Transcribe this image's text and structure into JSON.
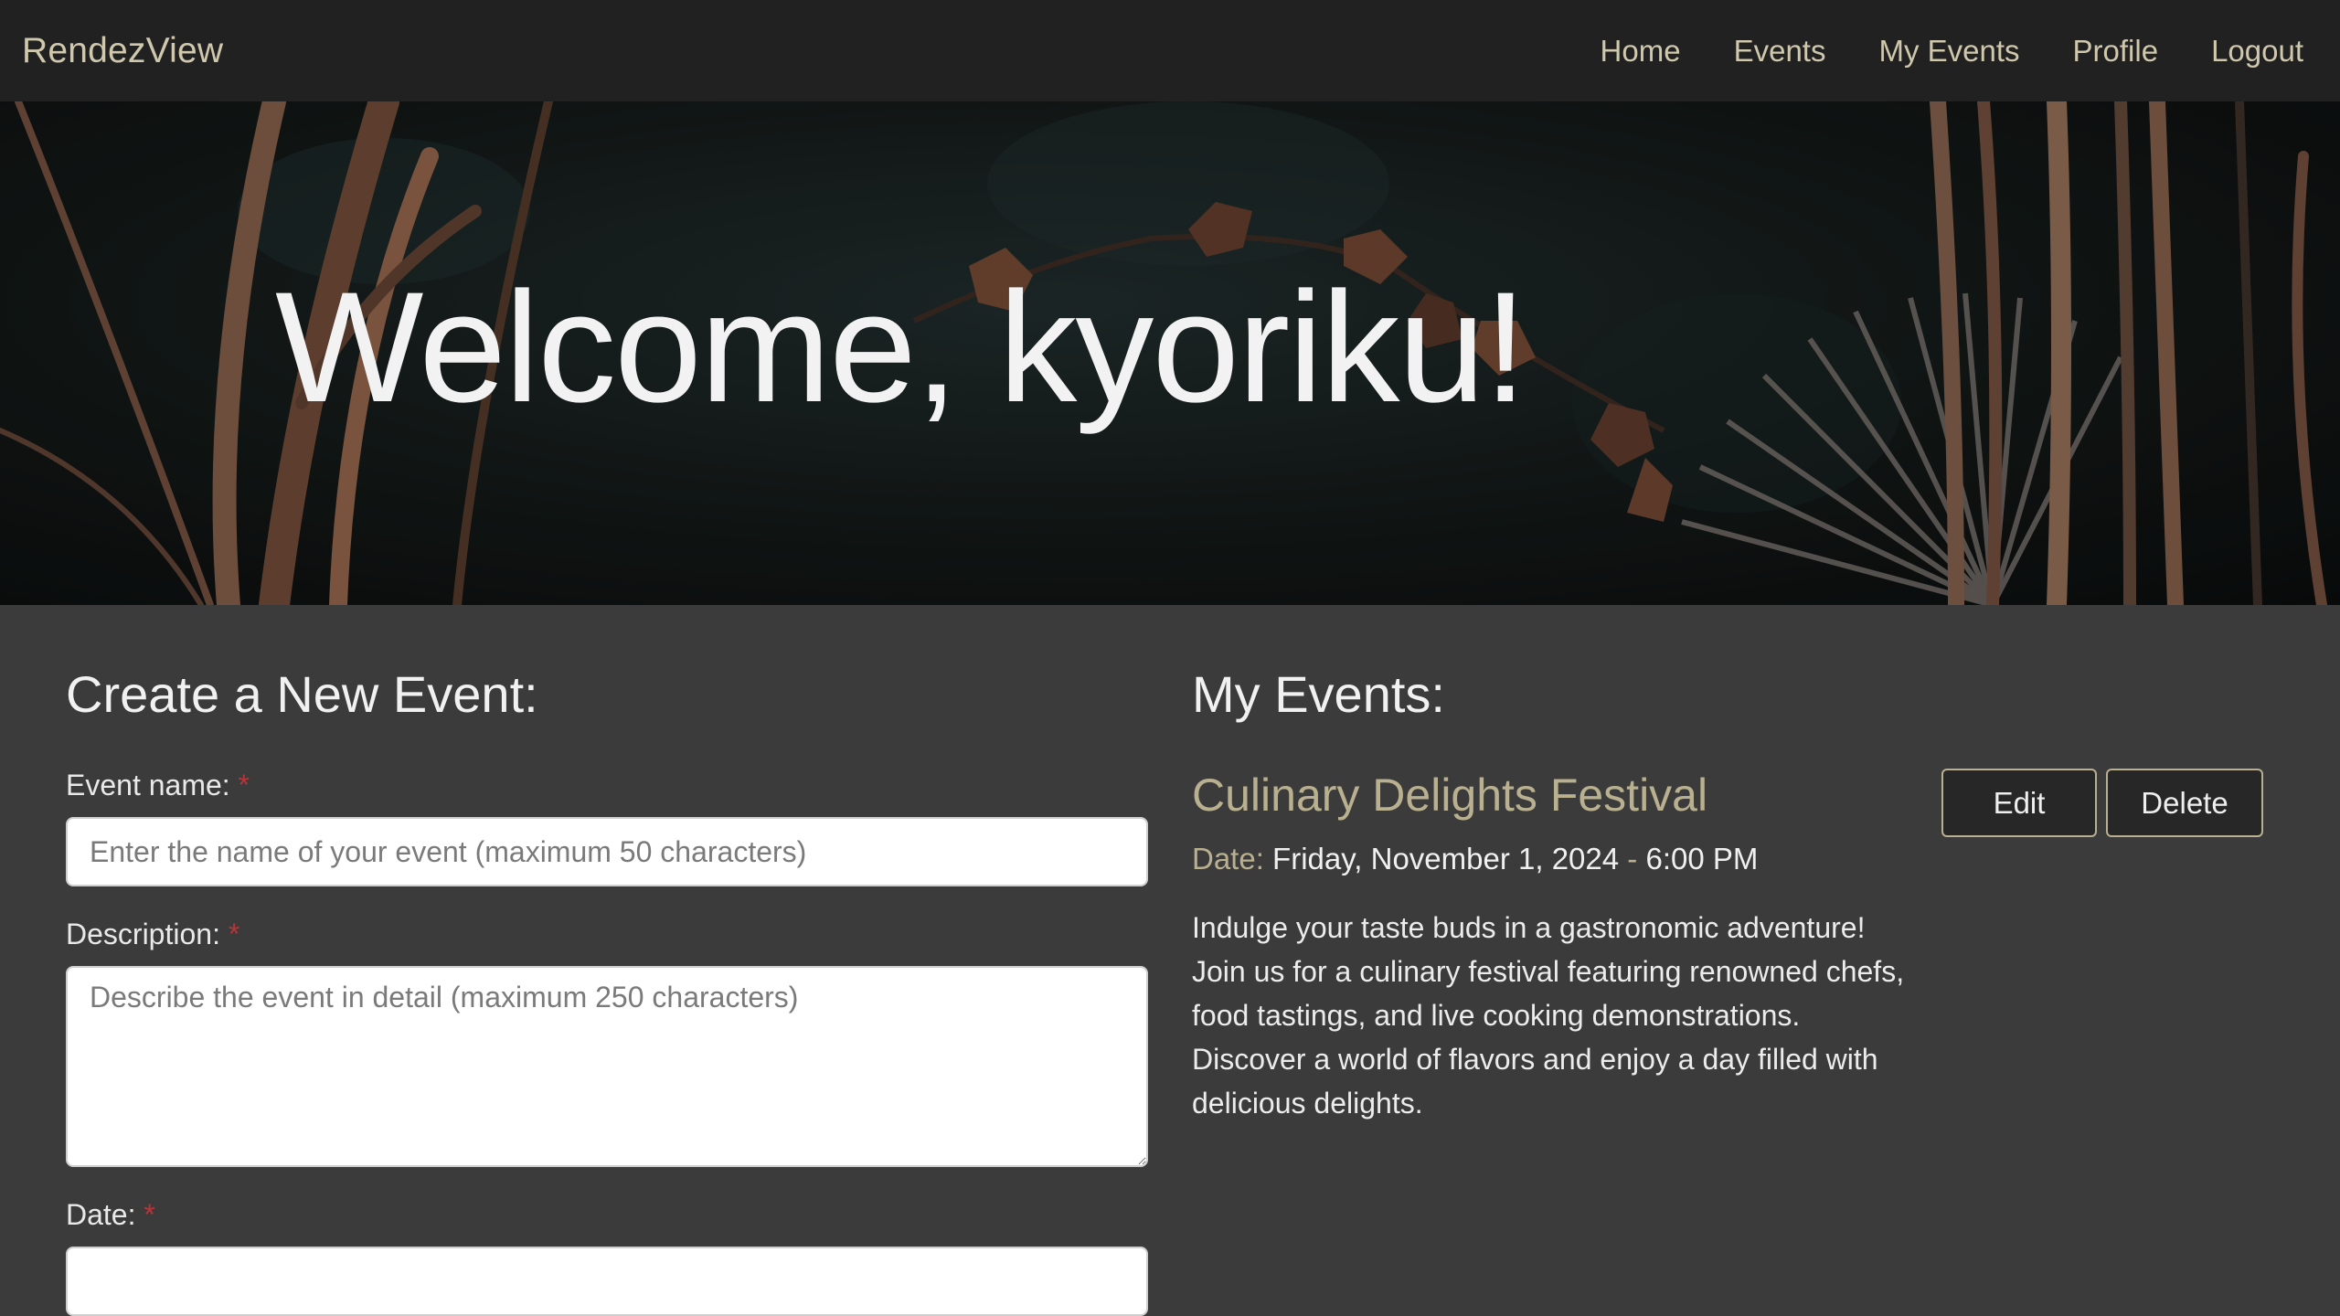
{
  "navbar": {
    "brand": "RendezView",
    "links": [
      "Home",
      "Events",
      "My Events",
      "Profile",
      "Logout"
    ]
  },
  "hero": {
    "title": "Welcome, kyoriku!"
  },
  "create_form": {
    "title": "Create a New Event:",
    "name_label": "Event name:",
    "name_placeholder": "Enter the name of your event (maximum 50 characters)",
    "description_label": "Description:",
    "description_placeholder": "Describe the event in detail (maximum 250 characters)",
    "date_label": "Date:",
    "required_marker": "*"
  },
  "my_events": {
    "title": "My Events:",
    "events": [
      {
        "name": "Culinary Delights Festival",
        "date_label": "Date:",
        "date": "Friday, November 1, 2024",
        "separator": "-",
        "time": "6:00 PM",
        "description": "Indulge your taste buds in a gastronomic adventure! Join us for a culinary festival featuring renowned chefs, food tastings, and live cooking demonstrations. Discover a world of flavors and enjoy a day filled with delicious delights.",
        "edit_label": "Edit",
        "delete_label": "Delete"
      }
    ]
  },
  "colors": {
    "navbar_bg": "#212121",
    "accent": "#b9b08f",
    "content_bg": "#3b3b3b",
    "required": "#b8343b"
  }
}
